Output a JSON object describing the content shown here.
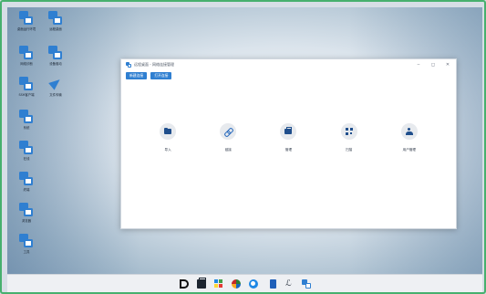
{
  "desktop": {
    "icons": [
      {
        "label": "桌面运行环境"
      },
      {
        "label": "远程桌面"
      },
      {
        "label": "网络诊断"
      },
      {
        "label": "设备驱动"
      },
      {
        "label": "SSH客户端"
      },
      {
        "label": "文件传输"
      },
      {
        "label": "系统"
      },
      {
        "label": "在线"
      },
      {
        "label": "终端"
      },
      {
        "label": "浏览器"
      },
      {
        "label": "工具"
      },
      {
        "label": "桌面"
      },
      {
        "label": "设置中心"
      }
    ]
  },
  "window": {
    "title": "远程桌面 - 网络连接管理",
    "buttons": [
      "新建连接",
      "打开连接"
    ],
    "controls": [
      "‒",
      "◻",
      "✕"
    ],
    "features": [
      {
        "label": "导入",
        "icon": "folder-icon"
      },
      {
        "label": "链接",
        "icon": "link-icon"
      },
      {
        "label": "管理",
        "icon": "briefcase-icon"
      },
      {
        "label": "扫描",
        "icon": "qr-icon"
      },
      {
        "label": "用户管理",
        "icon": "user-icon"
      }
    ]
  },
  "taskbar": {
    "items": [
      "app-d-icon",
      "briefcase-icon",
      "colorful-app-icon",
      "multicolor-ball-icon",
      "browser-icon",
      "notes-icon",
      "pen-icon",
      "remote-desktop-icon"
    ]
  }
}
